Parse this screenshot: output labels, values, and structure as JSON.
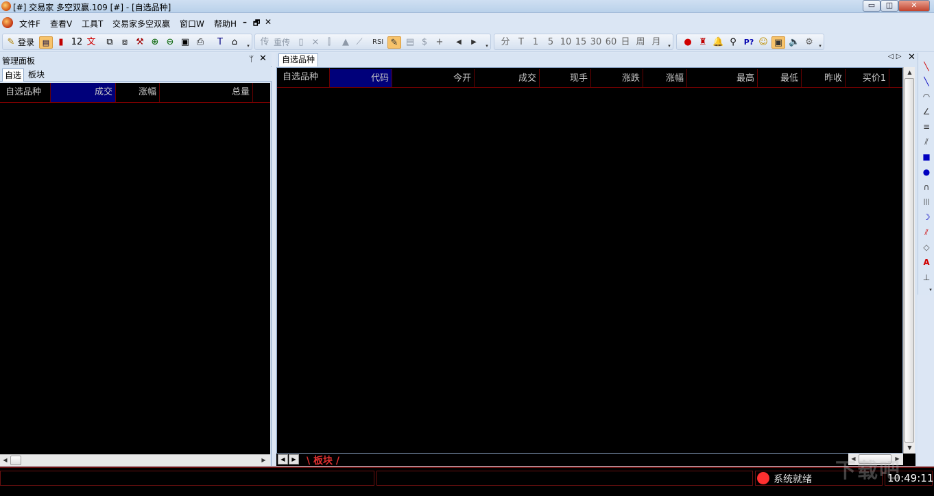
{
  "window": {
    "title": "[#] 交易家 多空双赢.109 [#] - [自选品种]",
    "min_glyph": "▭",
    "max_glyph": "◫",
    "close_glyph": "✕"
  },
  "menu": {
    "items": [
      "文件F",
      "查看V",
      "工具T",
      "交易家多空双赢",
      "窗口W",
      "帮助H"
    ],
    "mdi_min": "–",
    "mdi_restore": "🗗",
    "mdi_close": "✕"
  },
  "toolbar": {
    "login_label": "登录",
    "num12": "12",
    "wen": "文",
    "t_label": "T",
    "chuan": "传",
    "chongchuan": "重传",
    "rsi": "RSI",
    "dollar": "$",
    "plus": "+",
    "left": "◀",
    "right": "▶",
    "periods": [
      "分",
      "T",
      "1",
      "5",
      "10",
      "15",
      "30",
      "60",
      "日",
      "周",
      "月"
    ],
    "p_label": "P?",
    "more": "▾"
  },
  "left_panel": {
    "title": "管理面板",
    "pin": "ᛘ",
    "close": "✕",
    "tabs": [
      "自选",
      "板块"
    ],
    "columns": [
      "自选品种",
      "成交",
      "涨幅",
      "总量"
    ]
  },
  "right_panel": {
    "tab": "自选品种",
    "nav": "◁▷",
    "close": "✕",
    "columns": [
      "自选品种",
      "代码",
      "今开",
      "成交",
      "现手",
      "涨跌",
      "涨幅",
      "最高",
      "最低",
      "昨收",
      "买价1"
    ],
    "sheet_tab": "\\ 板块 /"
  },
  "scroll": {
    "left": "◀",
    "right": "▶",
    "up": "▲",
    "down": "▼"
  },
  "status": {
    "text": "系统就绪",
    "clock": "10:49:11"
  },
  "watermark": "下载吧",
  "draw_tools": [
    "╲",
    "╲",
    "◠",
    "∠",
    "≡",
    "⫽",
    "■",
    "●",
    "∩",
    "|||",
    "☽",
    "⫽",
    "◇",
    "A",
    "⊥",
    "▾"
  ],
  "colors": {
    "grid_bg": "#000000",
    "grid_header_text": "#c8c8c8",
    "selected_header": "#00007a",
    "grid_lines": "#800000",
    "sheet_tab": "#e03030",
    "status_dot": "#ff3030"
  }
}
